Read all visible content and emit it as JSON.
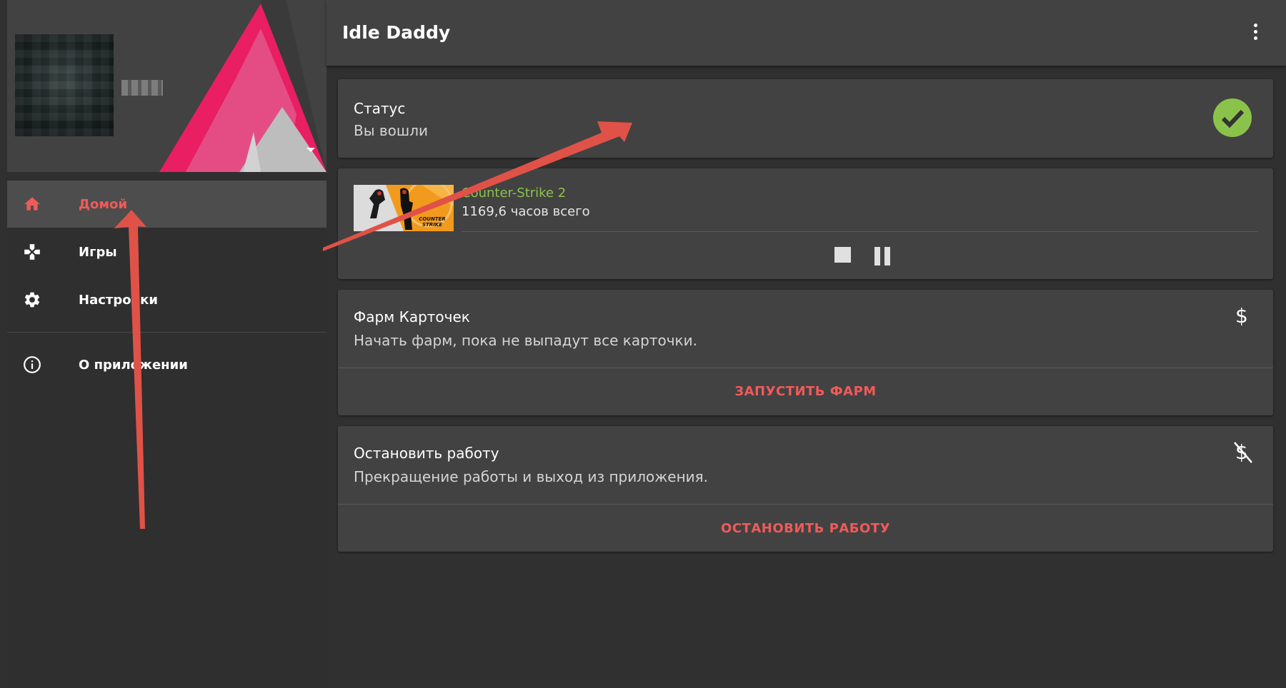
{
  "app": {
    "title": "Idle Daddy"
  },
  "drawer": {
    "username": "user",
    "items": [
      {
        "label": "Домой",
        "icon": "home-icon",
        "active": true
      },
      {
        "label": "Игры",
        "icon": "gamepad-icon",
        "active": false
      },
      {
        "label": "Настройки",
        "icon": "gear-icon",
        "active": false
      },
      {
        "label": "О приложении",
        "icon": "info-icon",
        "active": false
      }
    ]
  },
  "status": {
    "title": "Статус",
    "subtitle": "Вы вошли",
    "icon": "check-circle-icon"
  },
  "game": {
    "name": "Counter-Strike 2",
    "hours": "1169,6 часов всего",
    "thumb_text": "COUNTER STRIKE",
    "controls": [
      "stop-icon",
      "pause-icon"
    ]
  },
  "farm": {
    "title": "Фарм Карточек",
    "subtitle": "Начать фарм, пока не выпадут все карточки.",
    "icon_glyph": "$",
    "action": "ЗАПУСТИТЬ ФАРМ"
  },
  "stop": {
    "title": "Остановить работу",
    "subtitle": "Прекращение работы и выход из приложения.",
    "icon_glyph": "$",
    "action": "ОСТАНОВИТЬ РАБОТУ"
  },
  "colors": {
    "accent": "#f05a5a",
    "success": "#8bc34a",
    "header_pink": "#e91e63",
    "surface": "#424242",
    "background": "#303030"
  }
}
